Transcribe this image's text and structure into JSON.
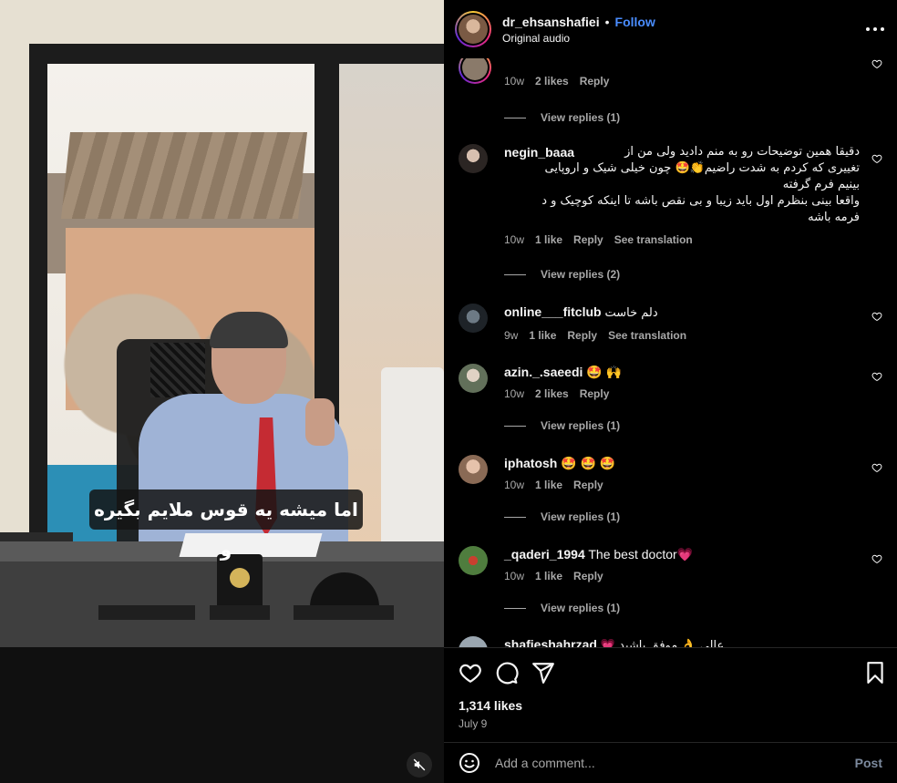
{
  "video": {
    "subtitle": "اما میشه یه قوس ملایم بگیره و",
    "mute_icon": "speaker-muted-icon"
  },
  "header": {
    "username": "dr_ehsanshafiei",
    "separator": "•",
    "follow_label": "Follow",
    "audio_label": "Original audio",
    "more_icon": "more-horizontal-icon"
  },
  "comments": [
    {
      "username": "",
      "text": "",
      "age": "10w",
      "likes": "2 likes",
      "reply": "Reply",
      "view_replies": "View replies (1)",
      "avatar_color": "#8a7a6a"
    },
    {
      "username": "negin_baaa",
      "text_lines": [
        "دقیقا همین توضیحات رو به منم دادید ولی من از",
        "تغییری که کردم به شدت راضیم👏🤩 چون خیلی شیک و اروپایی",
        "بینیم فرم گرفته",
        "واقعا بینی بنظرم اول باید زیبا و بی نقص باشه تا اینکه کوچیک و د",
        "فرمه باشه"
      ],
      "age": "10w",
      "likes": "1 like",
      "reply": "Reply",
      "translate": "See translation",
      "view_replies": "View replies (2)",
      "avatar_color": "#6b5a52"
    },
    {
      "username": "online___fitclub",
      "text": "دلم خاست",
      "age": "9w",
      "likes": "1 like",
      "reply": "Reply",
      "translate": "See translation",
      "avatar_color": "#3d4a55"
    },
    {
      "username": "azin._.saeedi",
      "text": "🤩 🙌",
      "age": "10w",
      "likes": "2 likes",
      "reply": "Reply",
      "view_replies": "View replies (1)",
      "avatar_color": "#7a8a72"
    },
    {
      "username": "iphatosh",
      "text": "🤩 🤩 🤩",
      "age": "10w",
      "likes": "1 like",
      "reply": "Reply",
      "view_replies": "View replies (1)",
      "avatar_color": "#c9a08a"
    },
    {
      "username": "_qaderi_1994",
      "text": "The best doctor💗",
      "age": "10w",
      "likes": "1 like",
      "reply": "Reply",
      "view_replies": "View replies (1)",
      "avatar_color": "#4f7d3e"
    },
    {
      "username": "shafieshahrzad",
      "text": "💗 عالی 👌 موفق باشید",
      "avatar_color": "#9aa6b0"
    }
  ],
  "actions": {
    "like_icon": "heart-icon",
    "comment_icon": "comment-icon",
    "share_icon": "share-icon",
    "save_icon": "bookmark-icon"
  },
  "likes_count": "1,314 likes",
  "post_date": "July 9",
  "comment_bar": {
    "emoji_icon": "emoji-icon",
    "placeholder": "Add a comment...",
    "post_label": "Post"
  },
  "colors": {
    "background": "#000000",
    "link": "#4a8dff",
    "secondary_text": "#a8a8a8",
    "post_disabled": "#7c8a9e"
  }
}
